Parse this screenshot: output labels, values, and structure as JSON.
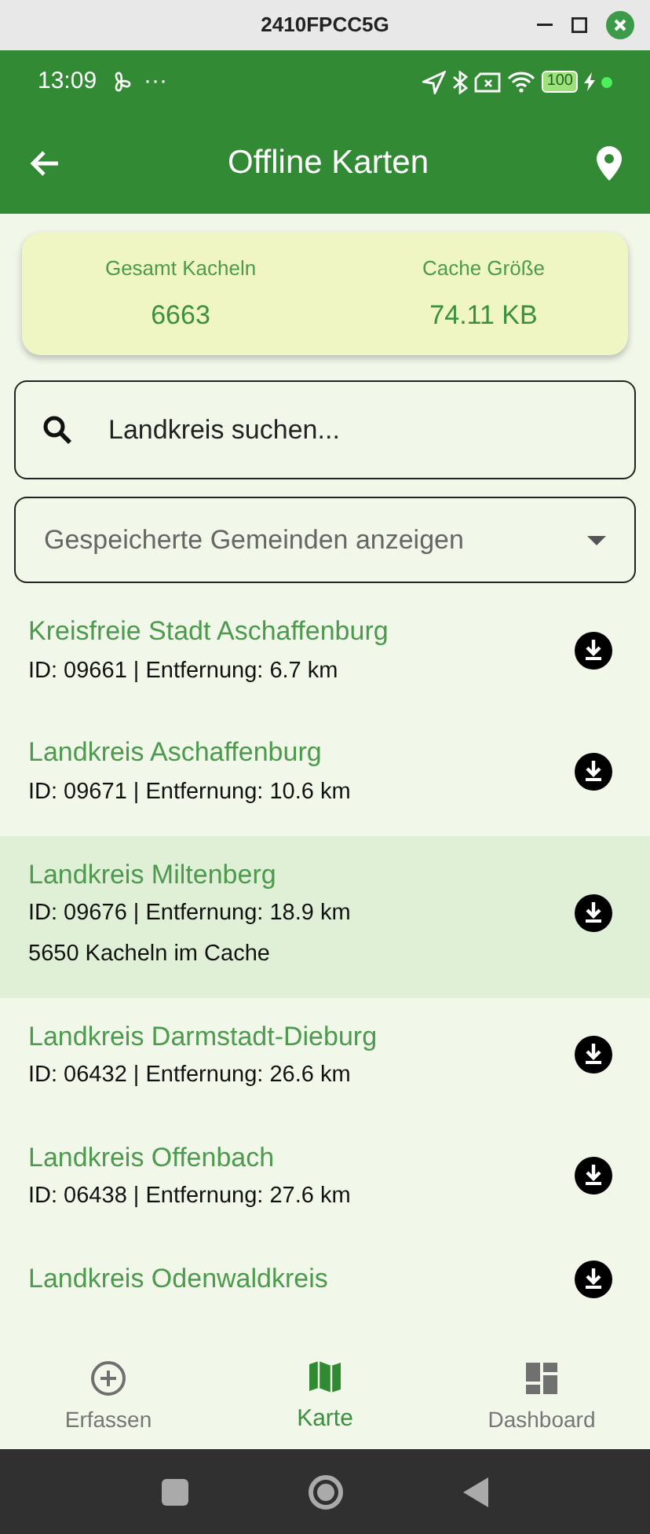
{
  "window": {
    "title": "2410FPCC5G"
  },
  "status_bar": {
    "time": "13:09",
    "dots": "···",
    "battery": "100"
  },
  "app_bar": {
    "title": "Offline Karten"
  },
  "stats": [
    {
      "label": "Gesamt Kacheln",
      "value": "6663"
    },
    {
      "label": "Cache Größe",
      "value": "74.11 KB"
    }
  ],
  "search": {
    "placeholder": "Landkreis suchen..."
  },
  "dropdown": {
    "placeholder": "Gespeicherte Gemeinden anzeigen"
  },
  "districts": [
    {
      "name": "Kreisfreie Stadt Aschaffenburg",
      "details": "ID: 09661 | Entfernung: 6.7 km",
      "selected": false
    },
    {
      "name": "Landkreis Aschaffenburg",
      "details": "ID: 09671 | Entfernung: 10.6 km",
      "selected": false
    },
    {
      "name": "Landkreis Miltenberg",
      "details": "ID: 09676 | Entfernung: 18.9 km",
      "cache": "5650 Kacheln im Cache",
      "selected": true
    },
    {
      "name": "Landkreis Darmstadt-Dieburg",
      "details": "ID: 06432 | Entfernung: 26.6 km",
      "selected": false
    },
    {
      "name": "Landkreis Offenbach",
      "details": "ID: 06438 | Entfernung: 27.6 km",
      "selected": false
    },
    {
      "name": "Landkreis Odenwaldkreis",
      "selected": false
    }
  ],
  "bottom_nav": [
    {
      "kind": "add",
      "label": "Erfassen",
      "selected": false
    },
    {
      "kind": "map",
      "label": "Karte",
      "selected": true
    },
    {
      "kind": "dashboard",
      "label": "Dashboard",
      "selected": false
    }
  ]
}
